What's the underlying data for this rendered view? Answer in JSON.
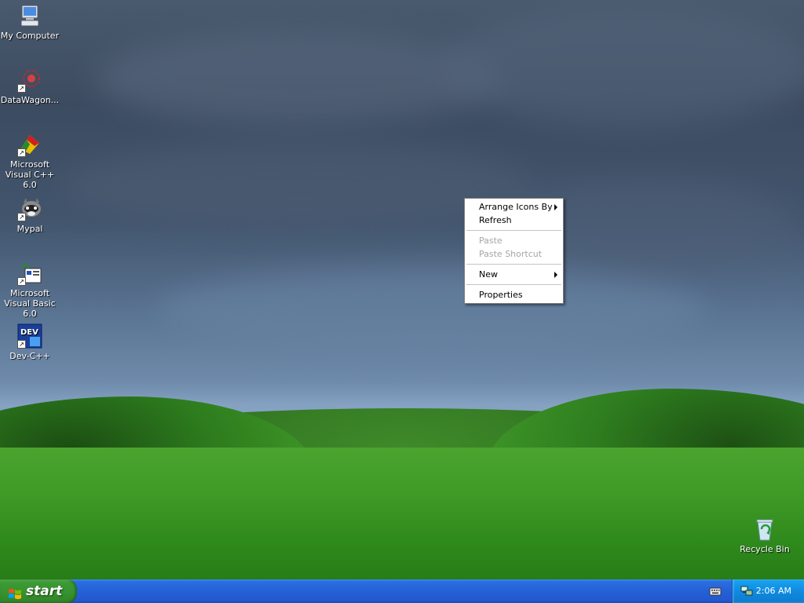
{
  "desktop": {
    "icons": [
      {
        "label": "My Computer",
        "icon": "my-computer-icon"
      },
      {
        "label": "DataWagon...",
        "icon": "datawagon-icon"
      },
      {
        "label": "Microsoft Visual C++ 6.0",
        "icon": "visual-cpp-icon"
      },
      {
        "label": "Mypal",
        "icon": "mypal-icon"
      },
      {
        "label": "Microsoft Visual Basic 6.0",
        "icon": "visual-basic-icon"
      },
      {
        "label": "Dev-C++",
        "icon": "dev-cpp-icon"
      },
      {
        "label": "Recycle Bin",
        "icon": "recycle-bin-icon"
      }
    ],
    "dev_badge": "DEV"
  },
  "context_menu": {
    "items": [
      {
        "label": "Arrange Icons By",
        "enabled": true,
        "submenu": true
      },
      {
        "label": "Refresh",
        "enabled": true,
        "submenu": false
      },
      {
        "label": "Paste",
        "enabled": false,
        "submenu": false
      },
      {
        "label": "Paste Shortcut",
        "enabled": false,
        "submenu": false
      },
      {
        "label": "New",
        "enabled": true,
        "submenu": true
      },
      {
        "label": "Properties",
        "enabled": true,
        "submenu": false
      }
    ]
  },
  "taskbar": {
    "start_label": "start",
    "clock": "2:06 AM",
    "tray_icons": [
      "keyboard-icon",
      "network-icon"
    ]
  },
  "colors": {
    "taskbar_blue": "#2560d6",
    "start_green": "#36922f",
    "tray_blue": "#0f8be0"
  }
}
